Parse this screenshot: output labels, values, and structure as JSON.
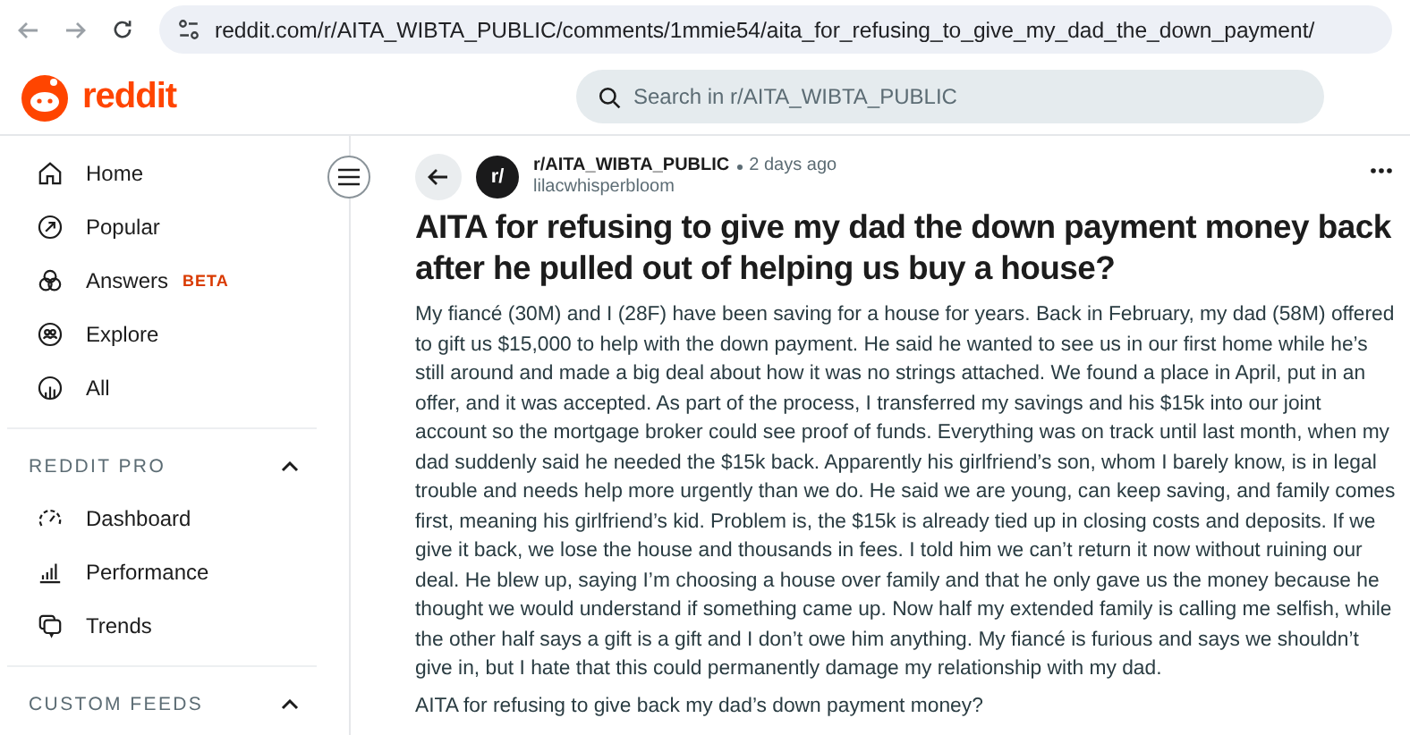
{
  "browser": {
    "url": "reddit.com/r/AITA_WIBTA_PUBLIC/comments/1mmie54/aita_for_refusing_to_give_my_dad_the_down_payment/"
  },
  "header": {
    "logo": "reddit",
    "search": {
      "placeholder": "Search in r/AITA_WIBTA_PUBLIC"
    }
  },
  "sidebar": {
    "items": [
      {
        "label": "Home",
        "kind": "home"
      },
      {
        "label": "Popular",
        "kind": "popular"
      },
      {
        "label": "Answers",
        "kind": "answers",
        "badge": "BETA"
      },
      {
        "label": "Explore",
        "kind": "explore"
      },
      {
        "label": "All",
        "kind": "all"
      }
    ],
    "sections": [
      {
        "title": "REDDIT PRO",
        "expanded": true,
        "items": [
          {
            "label": "Dashboard",
            "kind": "dashboard"
          },
          {
            "label": "Performance",
            "kind": "performance"
          },
          {
            "label": "Trends",
            "kind": "trends"
          }
        ]
      },
      {
        "title": "CUSTOM FEEDS",
        "expanded": true
      }
    ]
  },
  "post": {
    "avatar": "r/",
    "subreddit": "r/AITA_WIBTA_PUBLIC",
    "time": "2 days ago",
    "author": "lilacwhisperbloom",
    "title": "AITA for refusing to give my dad the down payment money back after he pulled out of helping us buy a house?",
    "paragraphs": [
      "My fiancé (30M) and I (28F) have been saving for a house for years. Back in February, my dad (58M) offered to gift us $15,000 to help with the down payment. He said he wanted to see us in our first home while he’s still around and made a big deal about how it was no strings attached. We found a place in April, put in an offer, and it was accepted. As part of the process, I transferred my savings and his $15k into our joint account so the mortgage broker could see proof of funds. Everything was on track until last month, when my dad suddenly said he needed the $15k back. Apparently his girlfriend’s son, whom I barely know, is in legal trouble and needs help more urgently than we do. He said we are young, can keep saving, and family comes first, meaning his girlfriend’s kid. Problem is, the $15k is already tied up in closing costs and deposits. If we give it back, we lose the house and thousands in fees. I told him we can’t return it now without ruining our deal. He blew up, saying I’m choosing a house over family and that he only gave us the money because he thought we would understand if something came up. Now half my extended family is calling me selfish, while the other half says a gift is a gift and I don’t owe him anything. My fiancé is furious and says we shouldn’t give in, but I hate that this could permanently damage my relationship with my dad.",
      "AITA for refusing to give back my dad’s down payment money?"
    ]
  }
}
